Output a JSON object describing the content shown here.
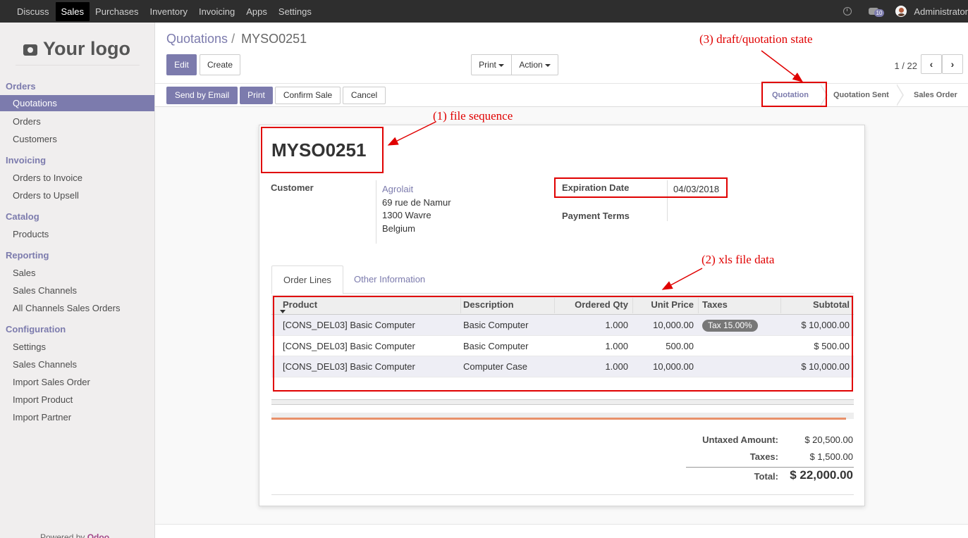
{
  "topbar": {
    "menu": [
      "Discuss",
      "Sales",
      "Purchases",
      "Inventory",
      "Invoicing",
      "Apps",
      "Settings"
    ],
    "active": "Sales",
    "message_count": "10",
    "user": "Administrator"
  },
  "sidebar": {
    "logo_text": "Your logo",
    "sections": [
      {
        "title": "Orders",
        "items": [
          "Quotations",
          "Orders",
          "Customers"
        ]
      },
      {
        "title": "Invoicing",
        "items": [
          "Orders to Invoice",
          "Orders to Upsell"
        ]
      },
      {
        "title": "Catalog",
        "items": [
          "Products"
        ]
      },
      {
        "title": "Reporting",
        "items": [
          "Sales",
          "Sales Channels",
          "All Channels Sales Orders"
        ]
      },
      {
        "title": "Configuration",
        "items": [
          "Settings",
          "Sales Channels",
          "Import Sales Order",
          "Import Product",
          "Import Partner"
        ]
      }
    ],
    "active_item": "Quotations",
    "powered_prefix": "Powered by",
    "powered_brand": "Odoo"
  },
  "breadcrumb": {
    "parent": "Quotations",
    "separator": "/",
    "current": "MYSO0251"
  },
  "buttons": {
    "edit": "Edit",
    "create": "Create",
    "print_menu": "Print",
    "action_menu": "Action",
    "send_email": "Send by Email",
    "print": "Print",
    "confirm": "Confirm Sale",
    "cancel": "Cancel"
  },
  "pager": {
    "value": "1 / 22"
  },
  "statusbar": [
    "Quotation",
    "Quotation Sent",
    "Sales Order"
  ],
  "status_current": "Quotation",
  "form": {
    "name": "MYSO0251",
    "customer_label": "Customer",
    "customer_name": "Agrolait",
    "address": [
      "69 rue de Namur",
      "1300 Wavre",
      "Belgium"
    ],
    "expiration_label": "Expiration Date",
    "expiration_value": "04/03/2018",
    "payment_terms_label": "Payment Terms"
  },
  "tabs": [
    "Order Lines",
    "Other Information"
  ],
  "table": {
    "columns": [
      "Product",
      "Description",
      "Ordered Qty",
      "Unit Price",
      "Taxes",
      "Subtotal"
    ],
    "rows": [
      {
        "product": "[CONS_DEL03] Basic Computer",
        "description": "Basic Computer",
        "qty": "1.000",
        "price": "10,000.00",
        "tax": "Tax 15.00%",
        "subtotal": "$ 10,000.00"
      },
      {
        "product": "[CONS_DEL03] Basic Computer",
        "description": "Basic Computer",
        "qty": "1.000",
        "price": "500.00",
        "tax": "",
        "subtotal": "$ 500.00"
      },
      {
        "product": "[CONS_DEL03] Basic Computer",
        "description": "Computer Case",
        "qty": "1.000",
        "price": "10,000.00",
        "tax": "",
        "subtotal": "$ 10,000.00"
      }
    ]
  },
  "totals": {
    "untaxed_label": "Untaxed Amount:",
    "untaxed": "$ 20,500.00",
    "taxes_label": "Taxes:",
    "taxes": "$ 1,500.00",
    "total_label": "Total:",
    "total": "$ 22,000.00"
  },
  "annotations": {
    "file_sequence": "(1) file sequence",
    "xls_data": "(2) xls file data",
    "state": "(3) draft/quotation state"
  },
  "colors": {
    "accent": "#7c7bad",
    "annotation": "#e00000",
    "topbar": "#2e2e2e"
  }
}
